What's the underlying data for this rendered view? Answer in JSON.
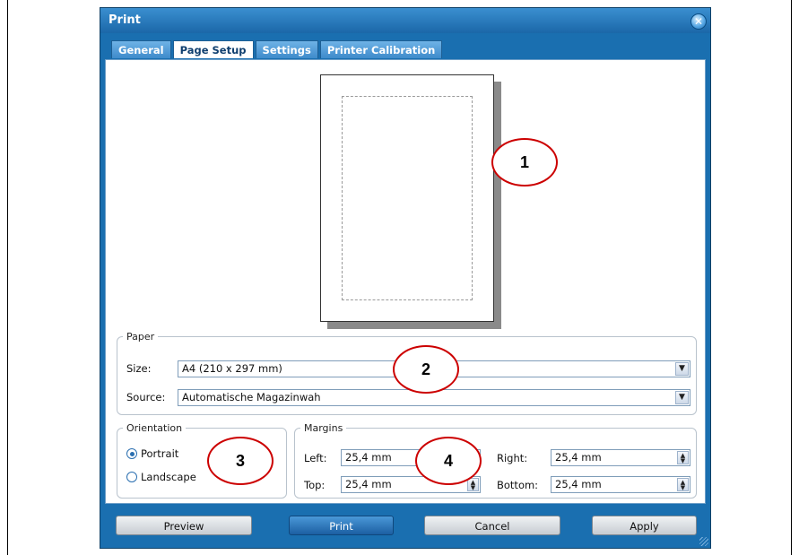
{
  "window": {
    "title": "Print",
    "close_icon": "close-icon"
  },
  "tabs": [
    {
      "label": "General",
      "active": false
    },
    {
      "label": "Page Setup",
      "active": true
    },
    {
      "label": "Settings",
      "active": false
    },
    {
      "label": "Printer Calibration",
      "active": false
    }
  ],
  "callouts": [
    "1",
    "2",
    "3",
    "4"
  ],
  "paper": {
    "legend": "Paper",
    "size_label": "Size:",
    "size_value": "A4 (210 x 297 mm)",
    "source_label": "Source:",
    "source_value": "Automatische Magazinwah",
    "dropdown_icon": "chevron-down-icon"
  },
  "orientation": {
    "legend": "Orientation",
    "options": [
      {
        "label": "Portrait",
        "checked": true
      },
      {
        "label": "Landscape",
        "checked": false
      }
    ]
  },
  "margins": {
    "legend": "Margins",
    "left_label": "Left:",
    "left_value": "25,4 mm",
    "top_label": "Top:",
    "top_value": "25,4 mm",
    "right_label": "Right:",
    "right_value": "25,4 mm",
    "bottom_label": "Bottom:",
    "bottom_value": "25,4 mm"
  },
  "buttons": {
    "preview": "Preview",
    "print": "Print",
    "cancel": "Cancel",
    "apply": "Apply"
  },
  "colors": {
    "accent": "#1a6fb0",
    "callout_border": "#cc0000",
    "primary_button": "#1c5fa2"
  }
}
